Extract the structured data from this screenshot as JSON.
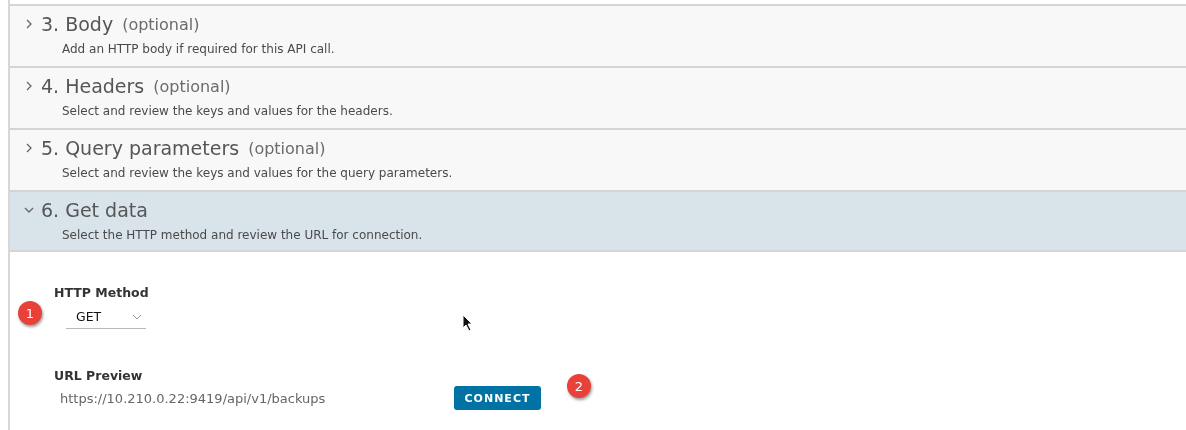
{
  "sections": [
    {
      "title": "3. Body",
      "optional": "(optional)",
      "description": "Add an HTTP body if required for this API call.",
      "expanded": false
    },
    {
      "title": "4. Headers",
      "optional": "(optional)",
      "description": "Select and review the keys and values for the headers.",
      "expanded": false
    },
    {
      "title": "5. Query parameters",
      "optional": "(optional)",
      "description": "Select and review the keys and values for the query parameters.",
      "expanded": false
    },
    {
      "title": "6. Get data",
      "description": "Select the HTTP method and review the URL for connection.",
      "expanded": true
    }
  ],
  "http_method": {
    "label": "HTTP Method",
    "value": "GET"
  },
  "url_preview": {
    "label": "URL Preview",
    "value": "https://10.210.0.22:9419/api/v1/backups"
  },
  "connect_button": "CONNECT",
  "callouts": [
    "1",
    "2"
  ]
}
